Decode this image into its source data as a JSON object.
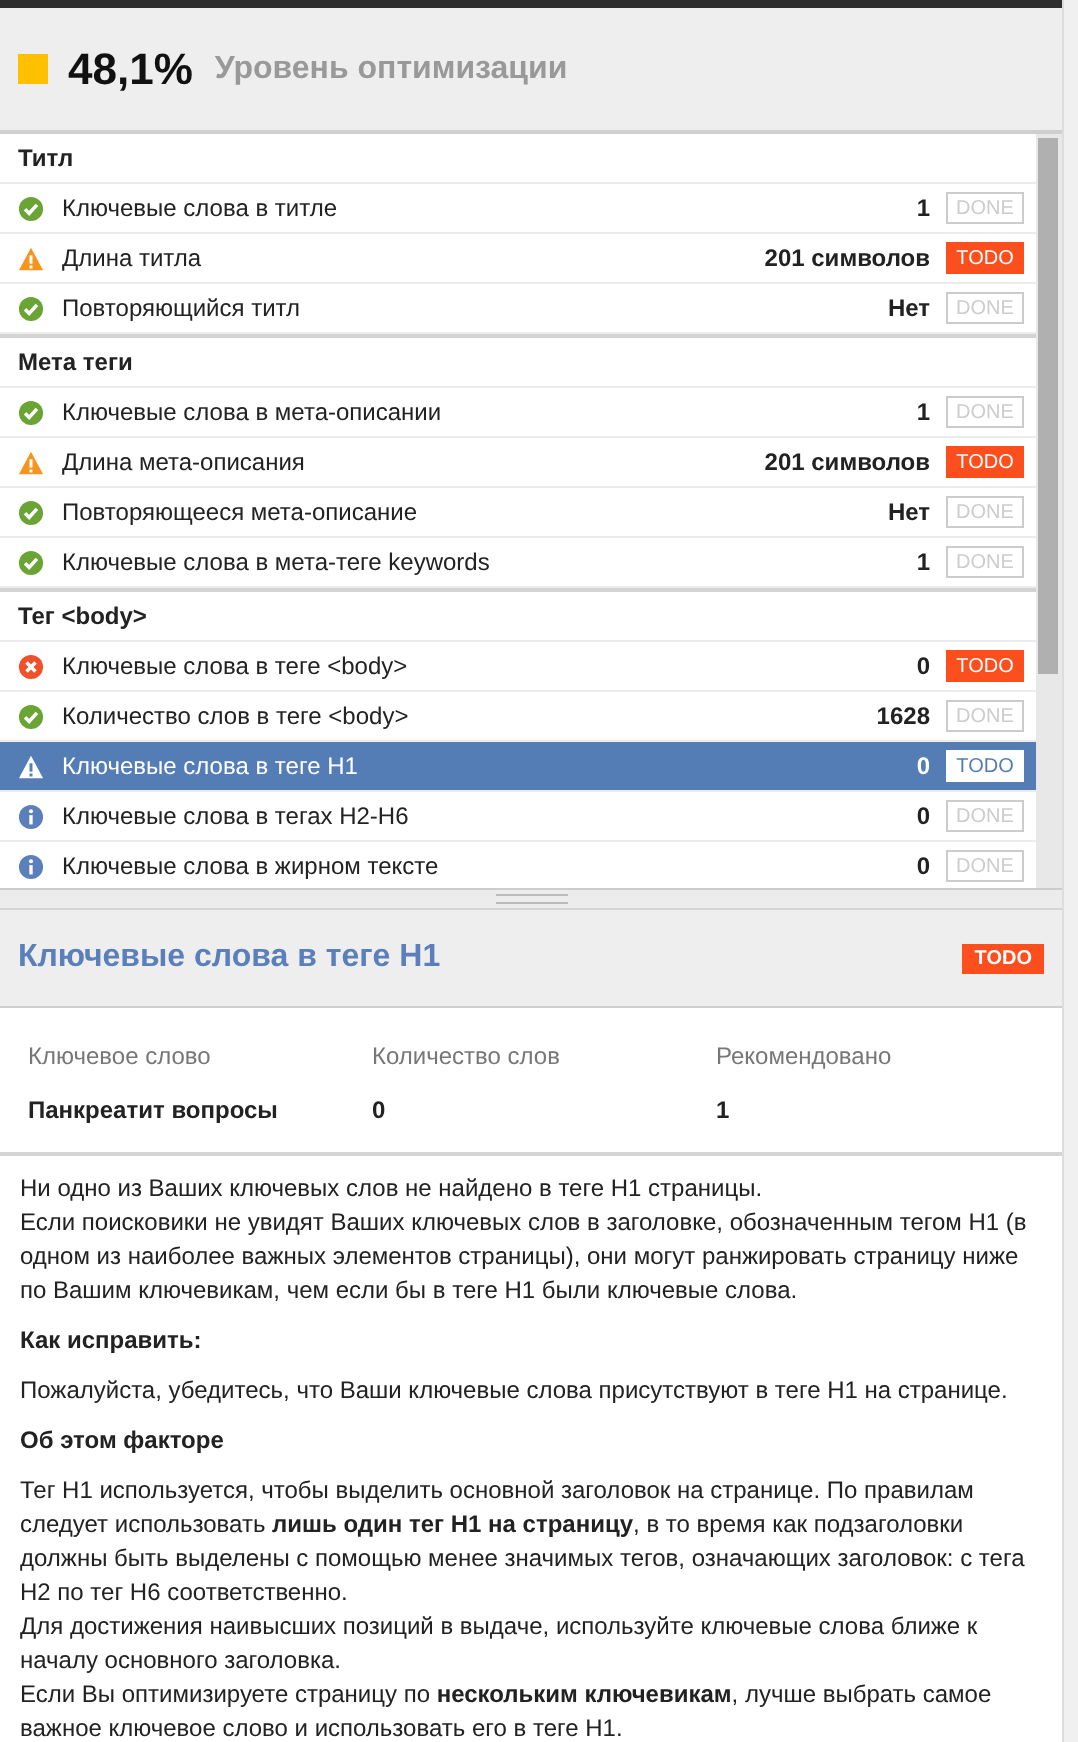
{
  "score": {
    "color": "#ffc000",
    "value": "48,1%",
    "label": "Уровень оптимизации"
  },
  "sections": [
    {
      "title": "Титл",
      "rows": [
        {
          "kind": "ok",
          "label": "Ключевые слова в титле",
          "value": "1",
          "action": {
            "label": "DONE",
            "pending": false
          },
          "selected": false
        },
        {
          "kind": "warning",
          "label": "Длина титла",
          "value": "201 символов",
          "action": {
            "label": "TODO",
            "pending": true
          },
          "selected": false
        },
        {
          "kind": "ok",
          "label": "Повторяющийся титл",
          "value": "Нет",
          "action": {
            "label": "DONE",
            "pending": false
          },
          "selected": false
        }
      ]
    },
    {
      "title": "Мета теги",
      "rows": [
        {
          "kind": "ok",
          "label": "Ключевые слова в мета-описании",
          "value": "1",
          "action": {
            "label": "DONE",
            "pending": false
          },
          "selected": false
        },
        {
          "kind": "warning",
          "label": "Длина мета-описания",
          "value": "201 символов",
          "action": {
            "label": "TODO",
            "pending": true
          },
          "selected": false
        },
        {
          "kind": "ok",
          "label": "Повторяющееся мета-описание",
          "value": "Нет",
          "action": {
            "label": "DONE",
            "pending": false
          },
          "selected": false
        },
        {
          "kind": "ok",
          "label": "Ключевые слова в мета-теге keywords",
          "value": "1",
          "action": {
            "label": "DONE",
            "pending": false
          },
          "selected": false
        }
      ]
    },
    {
      "title": "Тег <body>",
      "rows": [
        {
          "kind": "error",
          "label": "Ключевые слова в теге <body>",
          "value": "0",
          "action": {
            "label": "TODO",
            "pending": true
          },
          "selected": false
        },
        {
          "kind": "ok",
          "label": "Количество слов в теге <body>",
          "value": "1628",
          "action": {
            "label": "DONE",
            "pending": false
          },
          "selected": false
        },
        {
          "kind": "warning",
          "label": "Ключевые слова в теге H1",
          "value": "0",
          "action": {
            "label": "TODO",
            "pending": true
          },
          "selected": true
        },
        {
          "kind": "info",
          "label": "Ключевые слова в тегах H2-H6",
          "value": "0",
          "action": {
            "label": "DONE",
            "pending": false
          },
          "selected": false
        },
        {
          "kind": "info",
          "label": "Ключевые слова в жирном тексте",
          "value": "0",
          "action": {
            "label": "DONE",
            "pending": false
          },
          "selected": false
        }
      ]
    }
  ],
  "detail": {
    "title": "Ключевые слова в теге H1",
    "badge": "TODO",
    "table": {
      "columns": [
        "Ключевое слово",
        "Количество слов",
        "Рекомендовано"
      ],
      "rows": [
        [
          "Панкреатит вопросы",
          "0",
          "1"
        ]
      ]
    },
    "blocks": [
      {
        "kind": "text",
        "lines": [
          "Ни одно из Ваших ключевых слов не найдено в теге H1 страницы.",
          "Если поисковики не увидят Ваших ключевых слов в заголовке, обозначенным тегом H1 (в одном из наиболее важных элементов страницы), они могут ранжировать страницу ниже по Вашим ключевикам, чем если бы в теге H1 были ключевые слова."
        ]
      },
      {
        "kind": "heading",
        "lines": [
          "Как исправить:"
        ]
      },
      {
        "kind": "text",
        "lines": [
          "Пожалуйста, убедитесь, что Ваши ключевые слова присутствуют в теге H1 на странице."
        ]
      },
      {
        "kind": "heading",
        "lines": [
          "Об этом факторе"
        ]
      },
      {
        "kind": "text",
        "lines": [
          "Тег H1 используется, чтобы выделить основной заголовок на странице. По правилам следует использовать **лишь один тег H1 на страницу**, в то время как подзаголовки должны быть выделены с помощью менее значимых тегов, означающих заголовок: с тега H2 по тег H6 соответственно.",
          "Для достижения наивысших позиций в выдаче, используйте ключевые слова ближе к началу основного заголовка.",
          "Если Вы оптимизируете страницу по **нескольким ключевикам**, лучше выбрать самое важное ключевое слово и использовать его в теге H1."
        ]
      }
    ]
  }
}
